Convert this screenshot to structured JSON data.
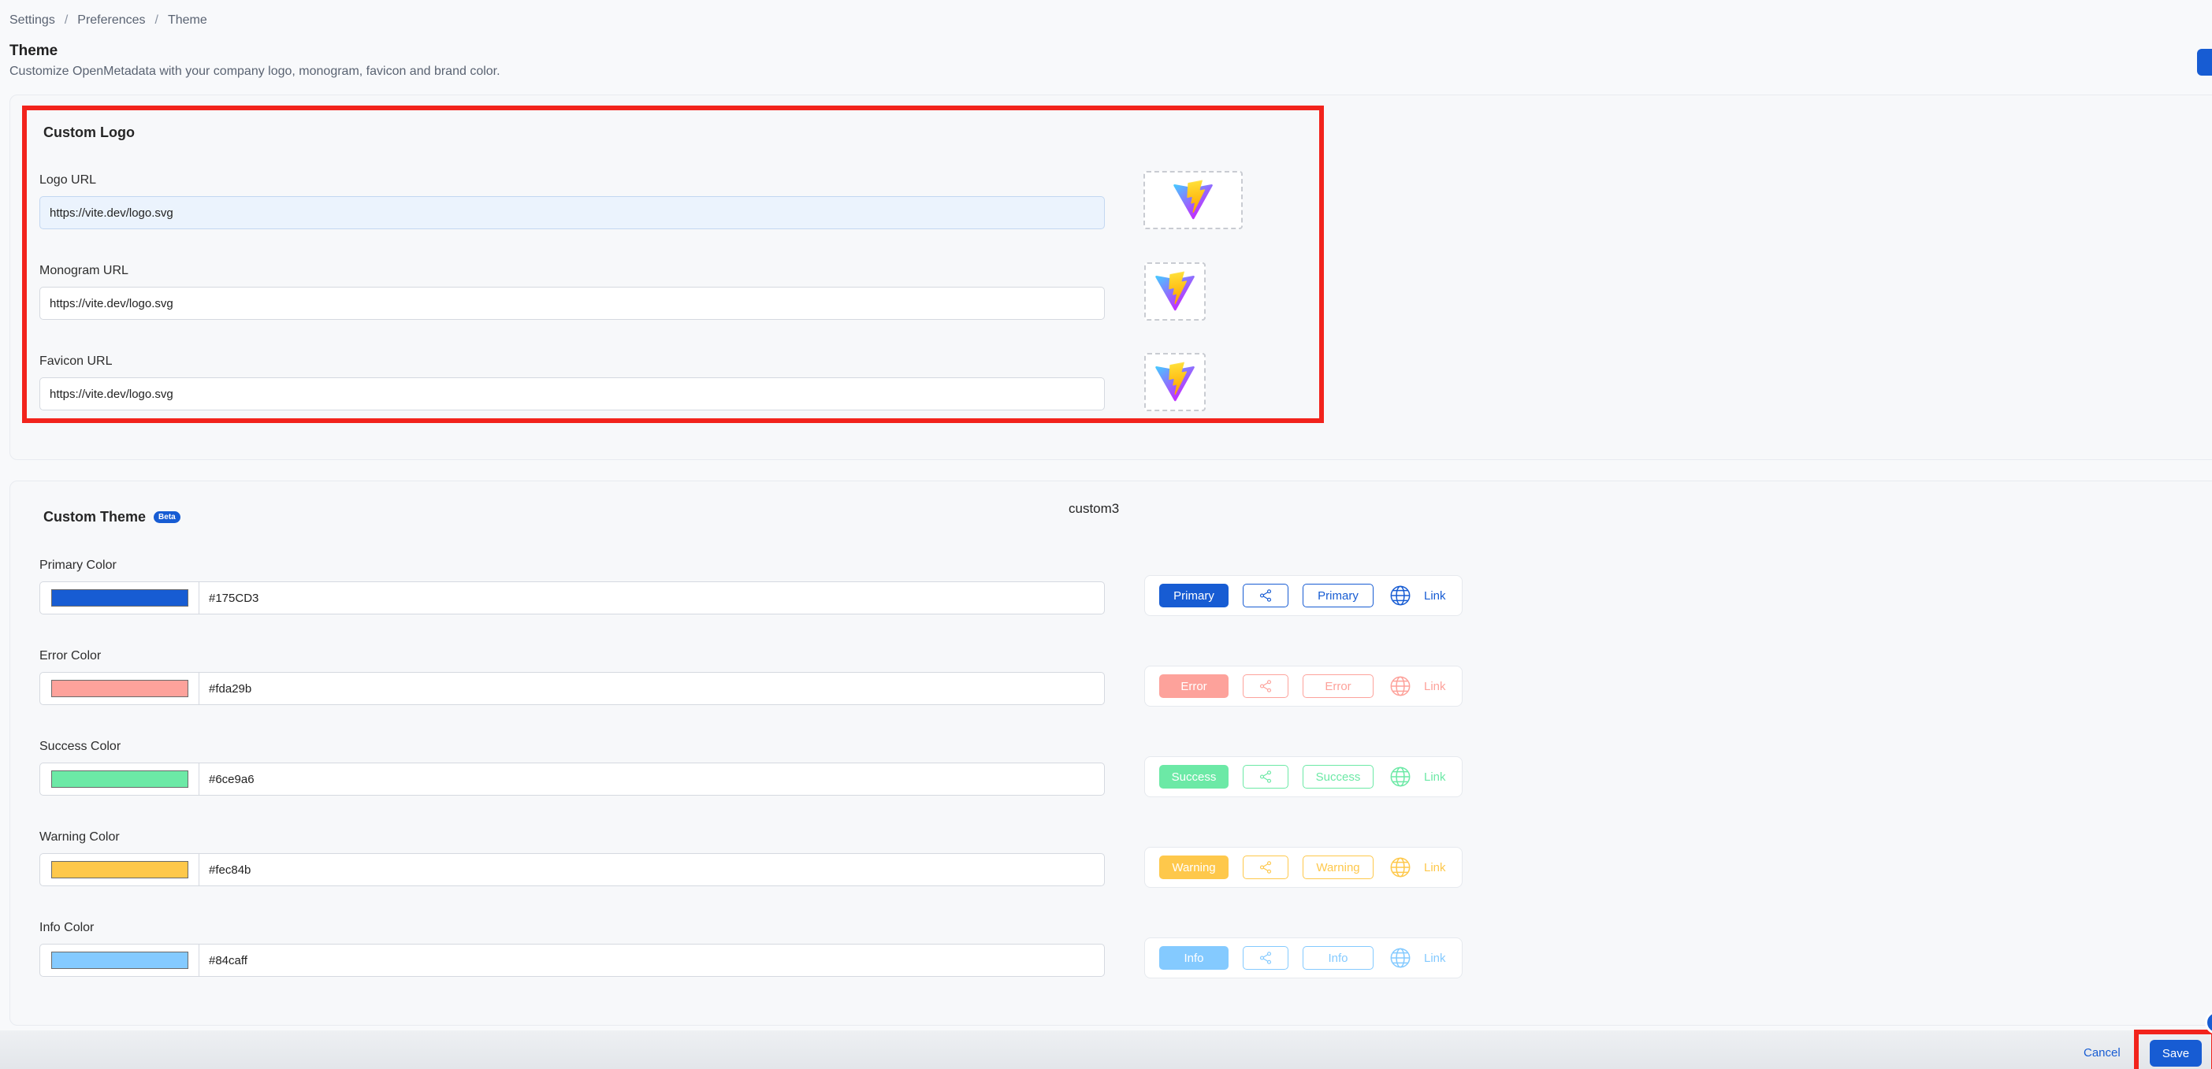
{
  "breadcrumb": [
    "Settings",
    "Preferences",
    "Theme"
  ],
  "page": {
    "title": "Theme",
    "subtitle": "Customize OpenMetadata with your company logo, monogram, favicon and brand color."
  },
  "logo_section": {
    "title": "Custom Logo",
    "fields": [
      {
        "label": "Logo URL",
        "value": "https://vite.dev/logo.svg"
      },
      {
        "label": "Monogram URL",
        "value": "https://vite.dev/logo.svg"
      },
      {
        "label": "Favicon URL",
        "value": "https://vite.dev/logo.svg"
      }
    ]
  },
  "theme_section": {
    "title": "Custom Theme",
    "badge": "Beta",
    "center_label": "custom3",
    "colors": [
      {
        "label": "Primary Color",
        "hex": "#175CD3",
        "swatch": "#175cd3",
        "button": "Primary",
        "link": "Link",
        "opacity": 1
      },
      {
        "label": "Error Color",
        "hex": "#fda29b",
        "swatch": "#fda29b",
        "button": "Error",
        "link": "Link",
        "opacity": 1
      },
      {
        "label": "Success Color",
        "hex": "#6ce9a6",
        "swatch": "#6ce9a6",
        "button": "Success",
        "link": "Link",
        "opacity": 1
      },
      {
        "label": "Warning Color",
        "hex": "#fec84b",
        "swatch": "#fec84b",
        "button": "Warning",
        "link": "Link",
        "opacity": 1
      },
      {
        "label": "Info Color",
        "hex": "#84caff",
        "swatch": "#84caff",
        "button": "Info",
        "link": "Link",
        "opacity": 1
      }
    ]
  },
  "footer": {
    "cancel_label": "Cancel",
    "save_label": "Save"
  },
  "icons": {
    "logo": "vite-logo-icon",
    "share": "share-icon",
    "globe": "globe-icon"
  }
}
